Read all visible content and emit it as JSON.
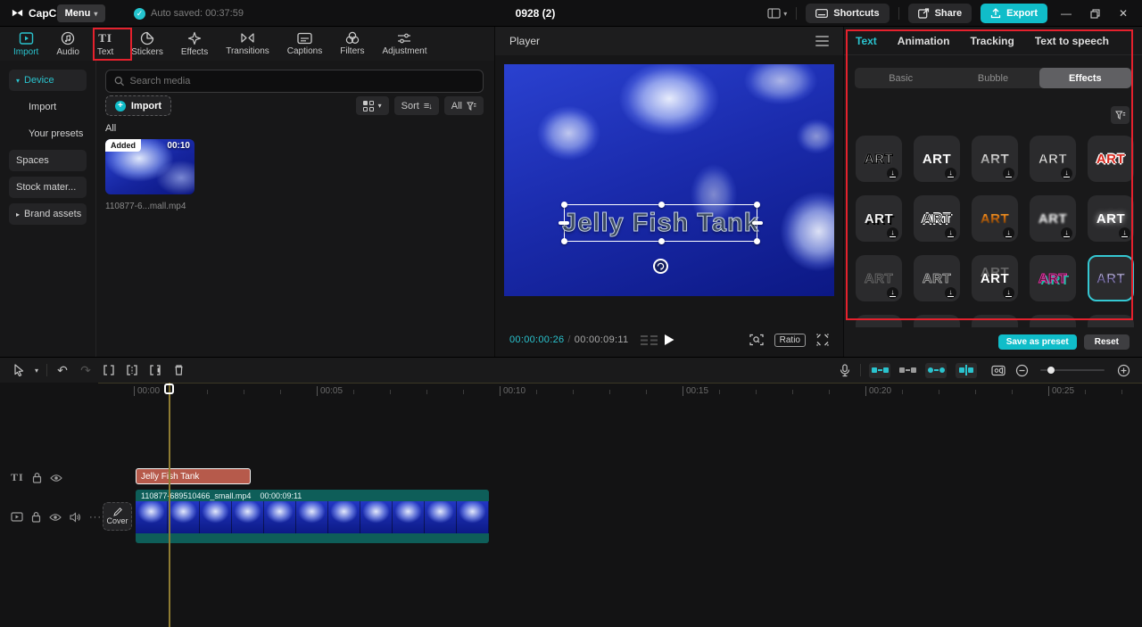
{
  "topbar": {
    "brand": "CapCut",
    "menu": "Menu",
    "autosave": "Auto saved: 00:37:59",
    "title": "0928 (2)",
    "shortcuts": "Shortcuts",
    "share": "Share",
    "export": "Export"
  },
  "media_tabs": {
    "items": [
      {
        "label": "Import",
        "active": true
      },
      {
        "label": "Audio"
      },
      {
        "label": "Text",
        "annotated": true
      },
      {
        "label": "Stickers"
      },
      {
        "label": "Effects"
      },
      {
        "label": "Transitions"
      },
      {
        "label": "Captions"
      },
      {
        "label": "Filters"
      },
      {
        "label": "Adjustment"
      }
    ]
  },
  "library": {
    "nav": [
      {
        "label": "Device",
        "active": true,
        "expanded": true
      },
      {
        "label": "Import"
      },
      {
        "label": "Your presets"
      },
      {
        "label": "Spaces"
      },
      {
        "label": "Stock mater..."
      },
      {
        "label": "Brand assets",
        "collapsed": true
      }
    ],
    "search_placeholder": "Search media",
    "import_button": "Import",
    "sort_label": "Sort",
    "filter_label": "All",
    "section_title": "All",
    "media_item": {
      "badge": "Added",
      "duration": "00:10",
      "filename": "110877-6...mall.mp4"
    }
  },
  "player": {
    "title": "Player",
    "overlay_text": "Jelly Fish Tank",
    "current_time": "00:00:00:26",
    "separator": "/",
    "duration": "00:00:09:11",
    "ratio": "Ratio"
  },
  "text_panel": {
    "tabs": [
      "Text",
      "Animation",
      "Tracking",
      "Text to speech"
    ],
    "active_tab": "Text",
    "segments": [
      "Basic",
      "Bubble",
      "Effects"
    ],
    "active_segment": "Effects",
    "art_label": "ART",
    "effects": [
      {
        "style": "white-black-outline",
        "downloadable": true
      },
      {
        "style": "bold-white",
        "downloadable": true
      },
      {
        "style": "silver-gradient",
        "downloadable": true
      },
      {
        "style": "white-thin-outline",
        "downloadable": true
      },
      {
        "style": "red-white-outline",
        "downloadable": false
      },
      {
        "style": "hard-drop-shadow",
        "downloadable": true
      },
      {
        "style": "bubble-double-outline",
        "downloadable": true
      },
      {
        "style": "fire-crackle",
        "downloadable": true
      },
      {
        "style": "soft-blur",
        "downloadable": true
      },
      {
        "style": "white-glow",
        "downloadable": true
      },
      {
        "style": "ghost-outline",
        "downloadable": true
      },
      {
        "style": "dark-gray-outline",
        "downloadable": true
      },
      {
        "style": "double-ghost",
        "downloadable": true
      },
      {
        "style": "neon-magenta-teal",
        "downloadable": false
      },
      {
        "style": "chrome-purple",
        "downloadable": false,
        "selected": true
      }
    ],
    "save_button": "Save as preset",
    "reset_button": "Reset"
  },
  "timeline": {
    "ruler_labels": [
      "00:00",
      "00:05",
      "00:10",
      "00:15",
      "00:20",
      "00:25"
    ],
    "text_clip_label": "Jelly Fish Tank",
    "video_clip_name": "110877-689510466_small.mp4",
    "video_clip_duration": "00:00:09:11",
    "cover_label": "Cover"
  },
  "colors": {
    "accent": "#2ac3ce",
    "annotation_red": "#e5212d",
    "export_button": "#10bdc9",
    "text_clip": "#b65a4b",
    "video_clip_teal": "#0e5e59"
  }
}
